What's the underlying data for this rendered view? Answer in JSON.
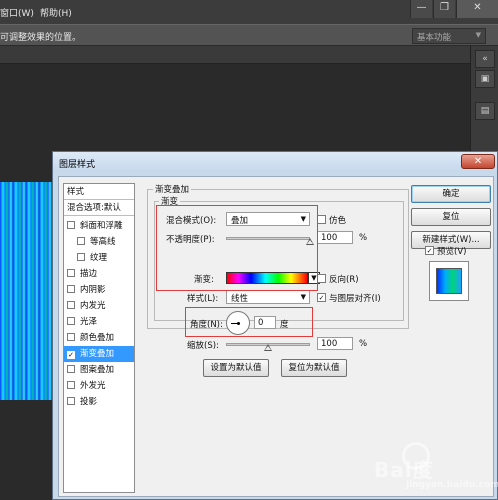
{
  "menubar": {
    "window_menu": "窗口(W)",
    "help_menu": "帮助(H)",
    "minimize": "—",
    "restore": "❐",
    "close": "✕"
  },
  "options_bar": {
    "hint": "可调整效果的位置。",
    "workspace_value": "基本功能"
  },
  "dialog": {
    "title": "图层样式",
    "style_list": {
      "header_styles": "样式",
      "header_blend": "混合选项:默认",
      "items": [
        {
          "label": "斜面和浮雕",
          "checked": false
        },
        {
          "label": "等高线",
          "checked": false
        },
        {
          "label": "纹理",
          "checked": false
        },
        {
          "label": "描边",
          "checked": false
        },
        {
          "label": "内阴影",
          "checked": false
        },
        {
          "label": "内发光",
          "checked": false
        },
        {
          "label": "光泽",
          "checked": false
        },
        {
          "label": "颜色叠加",
          "checked": false
        },
        {
          "label": "渐变叠加",
          "checked": true
        },
        {
          "label": "图案叠加",
          "checked": false
        },
        {
          "label": "外发光",
          "checked": false
        },
        {
          "label": "投影",
          "checked": false
        }
      ],
      "check_mark": "✓"
    },
    "gradient_overlay": {
      "section_title": "渐变叠加",
      "group_title": "渐变",
      "blend_mode_label": "混合模式(O):",
      "blend_mode_value": "叠加",
      "dither_label": "仿色",
      "opacity_label": "不透明度(P):",
      "opacity_value": "100",
      "opacity_unit": "%",
      "gradient_label": "渐变:",
      "reverse_label": "反向(R)",
      "style_label": "样式(L):",
      "style_value": "线性",
      "align_label": "与图层对齐(I)",
      "angle_label": "角度(N):",
      "angle_value": "0",
      "angle_unit": "度",
      "scale_label": "缩放(S):",
      "scale_value": "100",
      "scale_unit": "%",
      "make_default_button": "设置为默认值",
      "reset_default_button": "复位为默认值",
      "dropdown_arrow": "▼",
      "dither_checked": false,
      "reverse_checked": false,
      "align_checked": true,
      "opacity_fraction": 1.0,
      "scale_fraction": 0.5
    },
    "buttons": {
      "ok": "确定",
      "reset": "复位",
      "new_style": "新建样式(W)...",
      "preview_label": "预览(V)",
      "preview_checked": true
    }
  },
  "watermark": {
    "text": "Bai度",
    "sub": "jingyan.baidu.com"
  }
}
